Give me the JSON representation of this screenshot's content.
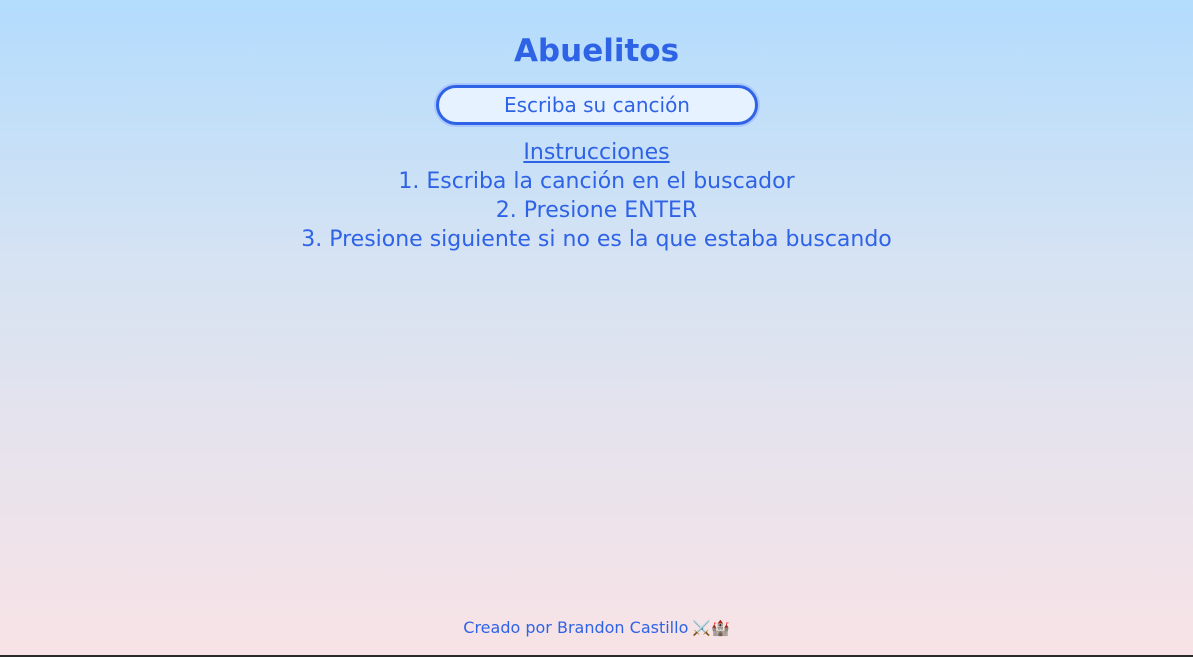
{
  "app": {
    "title": "Abuelitos"
  },
  "search": {
    "placeholder": "Escriba su canción",
    "value": ""
  },
  "instructions": {
    "heading": "Instrucciones",
    "steps": [
      "1. Escriba la canción en el buscador",
      "2. Presione ENTER",
      "3. Presione siguiente si no es la que estaba buscando"
    ]
  },
  "footer": {
    "text": "Creado por Brandon Castillo",
    "icons": "⚔️🏰"
  },
  "colors": {
    "accent": "#2f63e6",
    "background_top": "#b3dcfd",
    "background_bottom": "#f8e3e6"
  }
}
